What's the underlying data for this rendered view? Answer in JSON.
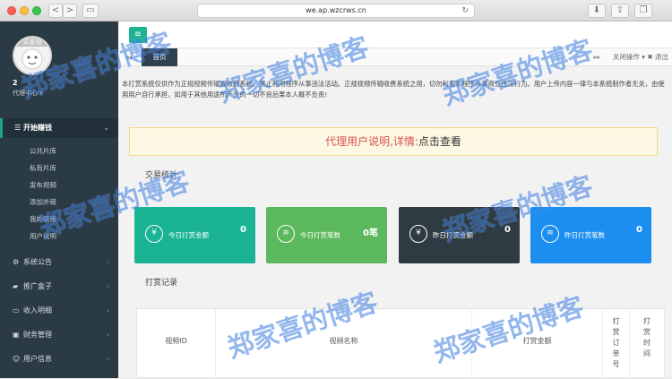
{
  "browser": {
    "url": "we.ap.wzcrws.cn",
    "back": "<",
    "forward": ">"
  },
  "sidebar": {
    "avatar_name": "买家相",
    "user_id": "2",
    "user_role": "代理中心 ▾",
    "active_menu": "开始赚钱",
    "sub_items": [
      "公共片库",
      "私有片库",
      "发布视频",
      "添加外链",
      "我的链接",
      "用户说明"
    ],
    "menus": [
      {
        "label": "系统公告",
        "icon": "gear-icon"
      },
      {
        "label": "推广盒子",
        "icon": "car-icon"
      },
      {
        "label": "收入明细",
        "icon": "inbox-icon"
      },
      {
        "label": "财务管理",
        "icon": "money-icon"
      },
      {
        "label": "用户信息",
        "icon": "users-icon"
      }
    ]
  },
  "tabs": {
    "home": "首页",
    "ops": "关闭操作 ▾",
    "exit": "✖ 退出"
  },
  "notice": "本打赏系统仅供作为正规视频传输或收费系统，禁止利用程序从事违法活动。正规视频传输收费系统之用，切勿利用本程序从事商业违法行为。用户上传内容一律与本系统制作者无关，由使用用户自行承担，如用于其他用途所产生的一切不良后果本人概不负责!",
  "banner": {
    "red_text": "代理用户说明,详情:",
    "black_text": "点击查看"
  },
  "stats_title": "交易统计",
  "cards": [
    {
      "label": "今日打赏金额",
      "value": "0",
      "color": "#1ab394",
      "icon": "¥"
    },
    {
      "label": "今日打赏笔数",
      "value": "0笔",
      "color": "#5cb85c",
      "icon": "≡"
    },
    {
      "label": "昨日打赏金额",
      "value": "0",
      "color": "#2f3b42",
      "icon": "¥"
    },
    {
      "label": "昨日打赏笔数",
      "value": "0",
      "color": "#1c8ef0",
      "icon": "≡"
    }
  ],
  "records_title": "打赏记录",
  "table_headers": [
    "视频ID",
    "视频名称",
    "打赏金额",
    "打赏订单号",
    "打赏时间"
  ],
  "watermark": "郑家喜的博客"
}
